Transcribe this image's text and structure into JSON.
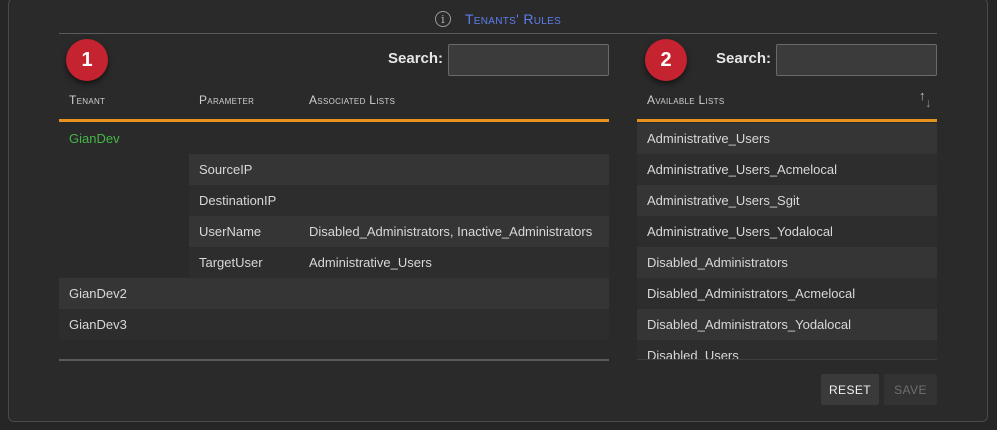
{
  "header": {
    "title": "Tenants' Rules",
    "info_icon": "info-icon"
  },
  "left": {
    "badge": "1",
    "search_label": "Search:",
    "search_value": "",
    "columns": [
      "Tenant",
      "Parameter",
      "Associated Lists"
    ],
    "rows": [
      {
        "tenant": "GianDev",
        "parameter": "",
        "lists": "",
        "bg": "#2a2a2a",
        "tenant_color": "#45b545"
      },
      {
        "tenant": "",
        "parameter": "SourceIP",
        "lists": "",
        "bg": "#353535",
        "tenant_color": "#d8d8d8"
      },
      {
        "tenant": "",
        "parameter": "DestinationIP",
        "lists": "",
        "bg": "#2d2d2d",
        "tenant_color": "#d8d8d8"
      },
      {
        "tenant": "",
        "parameter": "UserName",
        "lists": "Disabled_Administrators, Inactive_Administrators",
        "bg": "#353535",
        "tenant_color": "#d8d8d8"
      },
      {
        "tenant": "",
        "parameter": "TargetUser",
        "lists": "Administrative_Users",
        "bg": "#2d2d2d",
        "tenant_color": "#d8d8d8"
      },
      {
        "tenant": "GianDev2",
        "parameter": "",
        "lists": "",
        "bg": "#353535",
        "tenant_color": "#d8d8d8"
      },
      {
        "tenant": "GianDev3",
        "parameter": "",
        "lists": "",
        "bg": "#2d2d2d",
        "tenant_color": "#d8d8d8"
      }
    ]
  },
  "right": {
    "badge": "2",
    "search_label": "Search:",
    "search_value": "",
    "column": "Available Lists",
    "sort_icon": "sort-ascending-icon",
    "items": [
      "Administrative_Users",
      "Administrative_Users_Acmelocal",
      "Administrative_Users_Sgit",
      "Administrative_Users_Yodalocal",
      "Disabled_Administrators",
      "Disabled_Administrators_Acmelocal",
      "Disabled_Administrators_Yodalocal",
      "Disabled_Users"
    ]
  },
  "buttons": {
    "reset": "Reset",
    "save": "Save"
  },
  "colors": {
    "accent": "#e6921e",
    "title": "#5d7ef0",
    "badge": "#c4232f",
    "tenant_highlight": "#45b545"
  }
}
